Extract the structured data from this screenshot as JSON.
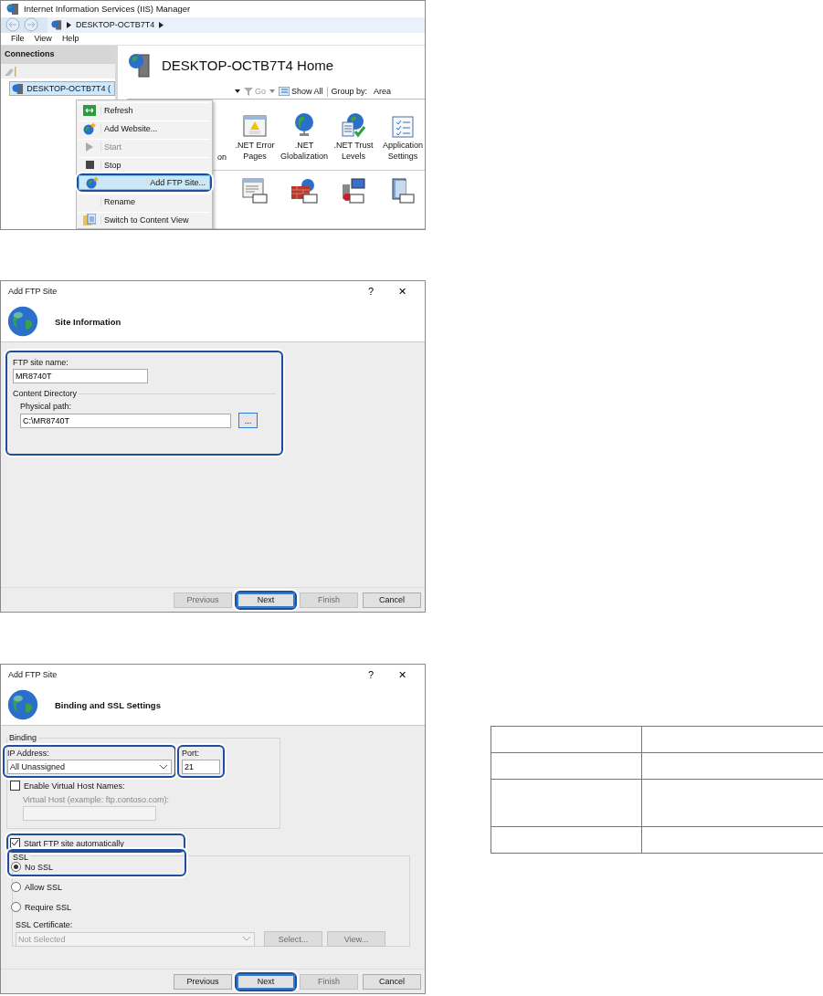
{
  "iis_manager": {
    "title": "Internet Information Services (IIS) Manager",
    "breadcrumb": [
      "DESKTOP-OCTB7T4"
    ],
    "menu": [
      "File",
      "View",
      "Help"
    ],
    "connections": {
      "title": "Connections",
      "tree": [
        {
          "label": "DESKTOP-OCTB7T4 (",
          "selected": true
        }
      ]
    },
    "home": {
      "title": "DESKTOP-OCTB7T4 Home",
      "filter": {
        "go": "Go",
        "show_all": "Show All",
        "group_by_label": "Group by:",
        "group_by_value": "Area"
      },
      "features": [
        {
          "label": "on"
        },
        {
          "label": ".NET Error Pages"
        },
        {
          "label": ".NET Globalization"
        },
        {
          "label": ".NET Trust Levels"
        },
        {
          "label": "Application Settings"
        }
      ]
    },
    "context_menu": [
      {
        "label": "Refresh",
        "disabled": false,
        "selected": false,
        "callout": false
      },
      {
        "label": "Add Website...",
        "disabled": false,
        "selected": false,
        "callout": false
      },
      {
        "label": "Start",
        "disabled": true,
        "selected": false,
        "callout": false
      },
      {
        "label": "Stop",
        "disabled": false,
        "selected": false,
        "callout": false
      },
      {
        "label": "Add FTP Site...",
        "disabled": false,
        "selected": true,
        "callout": true
      },
      {
        "label": "Rename",
        "disabled": false,
        "selected": false,
        "callout": false
      },
      {
        "label": "Switch to Content View",
        "disabled": false,
        "selected": false,
        "callout": false
      }
    ]
  },
  "site_information_dialog": {
    "title": "Add FTP Site",
    "help": "?",
    "close": "✕",
    "heading": "Site Information",
    "site_name": {
      "label": "FTP site name:",
      "value": "MR8740T"
    },
    "content_directory": "Content Directory",
    "physical_path": {
      "label": "Physical path:",
      "value": "C:\\MR8740T",
      "browse": "..."
    },
    "callout": true,
    "buttons": [
      {
        "label": "Previous",
        "disabled": true,
        "callout": false
      },
      {
        "label": "Next",
        "disabled": false,
        "callout": true
      },
      {
        "label": "Finish",
        "disabled": true,
        "callout": false
      },
      {
        "label": "Cancel",
        "disabled": false,
        "callout": false
      }
    ]
  },
  "binding_dialog": {
    "title": "Add FTP Site",
    "help": "?",
    "close": "✕",
    "heading": "Binding and SSL Settings",
    "binding": {
      "title": "Binding",
      "ip_address": {
        "label": "IP Address:",
        "value": "All Unassigned",
        "callout": true
      },
      "port": {
        "label": "Port:",
        "value": "21",
        "callout": true
      },
      "virtual_host_names": {
        "label": "Enable Virtual Host Names:",
        "checked": false
      },
      "virtual_host": {
        "label": "Virtual Host (example: ftp.contoso.com):",
        "disabled": true
      }
    },
    "start_automatically": {
      "label": "Start FTP site automatically",
      "checked": true,
      "callout": true
    },
    "ssl": {
      "title": "SSL",
      "options": [
        {
          "label": "No SSL",
          "selected": true,
          "callout": true
        },
        {
          "label": "Allow SSL",
          "selected": false,
          "callout": false
        },
        {
          "label": "Require SSL",
          "selected": false,
          "callout": false
        }
      ],
      "certificate": {
        "label": "SSL Certificate:",
        "value": "Not Selected",
        "disabled": true
      },
      "select": {
        "label": "Select...",
        "disabled": true
      },
      "view": {
        "label": "View...",
        "disabled": true
      }
    },
    "buttons": [
      {
        "label": "Previous",
        "disabled": false,
        "callout": false
      },
      {
        "label": "Next",
        "disabled": false,
        "callout": true
      },
      {
        "label": "Finish",
        "disabled": true,
        "callout": false
      },
      {
        "label": "Cancel",
        "disabled": false,
        "callout": false
      }
    ]
  },
  "blank_table": {
    "rows": [
      {
        "kind": "short"
      },
      {
        "kind": "short"
      },
      {
        "kind": "tall"
      },
      {
        "kind": "short"
      }
    ]
  }
}
